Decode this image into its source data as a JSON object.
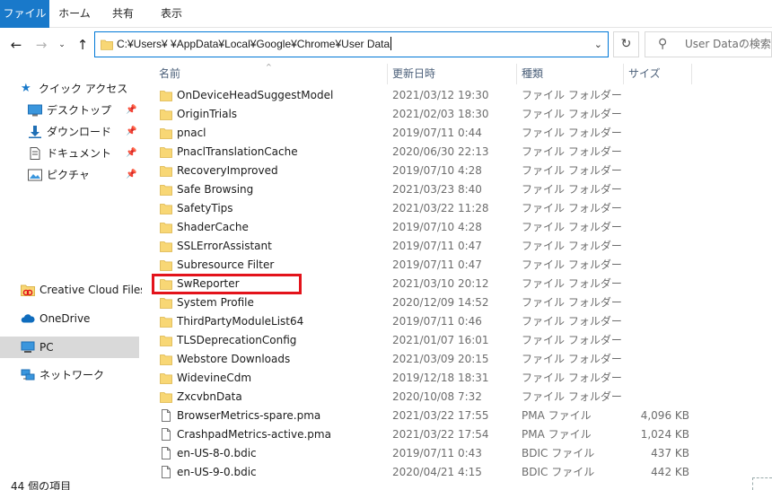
{
  "ribbon": {
    "tabs": [
      {
        "label": "ファイル"
      },
      {
        "label": "ホーム"
      },
      {
        "label": "共有"
      },
      {
        "label": "表示"
      }
    ]
  },
  "address": {
    "path": "C:¥Users¥          ¥AppData¥Local¥Google¥Chrome¥User Data",
    "search_placeholder": "User Dataの検索"
  },
  "nav": {
    "quick_access": "クイック アクセス",
    "items": [
      {
        "label": "デスクトップ",
        "pinned": true
      },
      {
        "label": "ダウンロード",
        "pinned": true
      },
      {
        "label": "ドキュメント",
        "pinned": true
      },
      {
        "label": "ピクチャ",
        "pinned": true
      }
    ],
    "creative_cloud": "Creative Cloud Files",
    "onedrive": "OneDrive",
    "pc": "PC",
    "network": "ネットワーク"
  },
  "columns": {
    "name": "名前",
    "date": "更新日時",
    "type": "種類",
    "size": "サイズ"
  },
  "files": [
    {
      "name": "OnDeviceHeadSuggestModel",
      "date": "2021/03/12 19:30",
      "type": "ファイル フォルダー",
      "size": "",
      "kind": "folder"
    },
    {
      "name": "OriginTrials",
      "date": "2021/02/03 18:30",
      "type": "ファイル フォルダー",
      "size": "",
      "kind": "folder"
    },
    {
      "name": "pnacl",
      "date": "2019/07/11 0:44",
      "type": "ファイル フォルダー",
      "size": "",
      "kind": "folder"
    },
    {
      "name": "PnaclTranslationCache",
      "date": "2020/06/30 22:13",
      "type": "ファイル フォルダー",
      "size": "",
      "kind": "folder"
    },
    {
      "name": "RecoveryImproved",
      "date": "2019/07/10 4:28",
      "type": "ファイル フォルダー",
      "size": "",
      "kind": "folder"
    },
    {
      "name": "Safe Browsing",
      "date": "2021/03/23 8:40",
      "type": "ファイル フォルダー",
      "size": "",
      "kind": "folder"
    },
    {
      "name": "SafetyTips",
      "date": "2021/03/22 11:28",
      "type": "ファイル フォルダー",
      "size": "",
      "kind": "folder"
    },
    {
      "name": "ShaderCache",
      "date": "2019/07/10 4:28",
      "type": "ファイル フォルダー",
      "size": "",
      "kind": "folder"
    },
    {
      "name": "SSLErrorAssistant",
      "date": "2019/07/11 0:47",
      "type": "ファイル フォルダー",
      "size": "",
      "kind": "folder"
    },
    {
      "name": "Subresource Filter",
      "date": "2019/07/11 0:47",
      "type": "ファイル フォルダー",
      "size": "",
      "kind": "folder"
    },
    {
      "name": "SwReporter",
      "date": "2021/03/10 20:12",
      "type": "ファイル フォルダー",
      "size": "",
      "kind": "folder"
    },
    {
      "name": "System Profile",
      "date": "2020/12/09 14:52",
      "type": "ファイル フォルダー",
      "size": "",
      "kind": "folder"
    },
    {
      "name": "ThirdPartyModuleList64",
      "date": "2019/07/11 0:46",
      "type": "ファイル フォルダー",
      "size": "",
      "kind": "folder"
    },
    {
      "name": "TLSDeprecationConfig",
      "date": "2021/01/07 16:01",
      "type": "ファイル フォルダー",
      "size": "",
      "kind": "folder"
    },
    {
      "name": "Webstore Downloads",
      "date": "2021/03/09 20:15",
      "type": "ファイル フォルダー",
      "size": "",
      "kind": "folder"
    },
    {
      "name": "WidevineCdm",
      "date": "2019/12/18 18:31",
      "type": "ファイル フォルダー",
      "size": "",
      "kind": "folder"
    },
    {
      "name": "ZxcvbnData",
      "date": "2020/10/08 7:32",
      "type": "ファイル フォルダー",
      "size": "",
      "kind": "folder"
    },
    {
      "name": "BrowserMetrics-spare.pma",
      "date": "2021/03/22 17:55",
      "type": "PMA ファイル",
      "size": "4,096 KB",
      "kind": "file"
    },
    {
      "name": "CrashpadMetrics-active.pma",
      "date": "2021/03/22 17:54",
      "type": "PMA ファイル",
      "size": "1,024 KB",
      "kind": "file"
    },
    {
      "name": "en-US-8-0.bdic",
      "date": "2019/07/11 0:43",
      "type": "BDIC ファイル",
      "size": "437 KB",
      "kind": "file"
    },
    {
      "name": "en-US-9-0.bdic",
      "date": "2020/04/21 4:15",
      "type": "BDIC ファイル",
      "size": "442 KB",
      "kind": "file"
    }
  ],
  "status": {
    "count": "44 個の項目"
  },
  "colors": {
    "accent": "#1979ca",
    "highlight": "#e3131b",
    "folder": "#f8d775"
  }
}
